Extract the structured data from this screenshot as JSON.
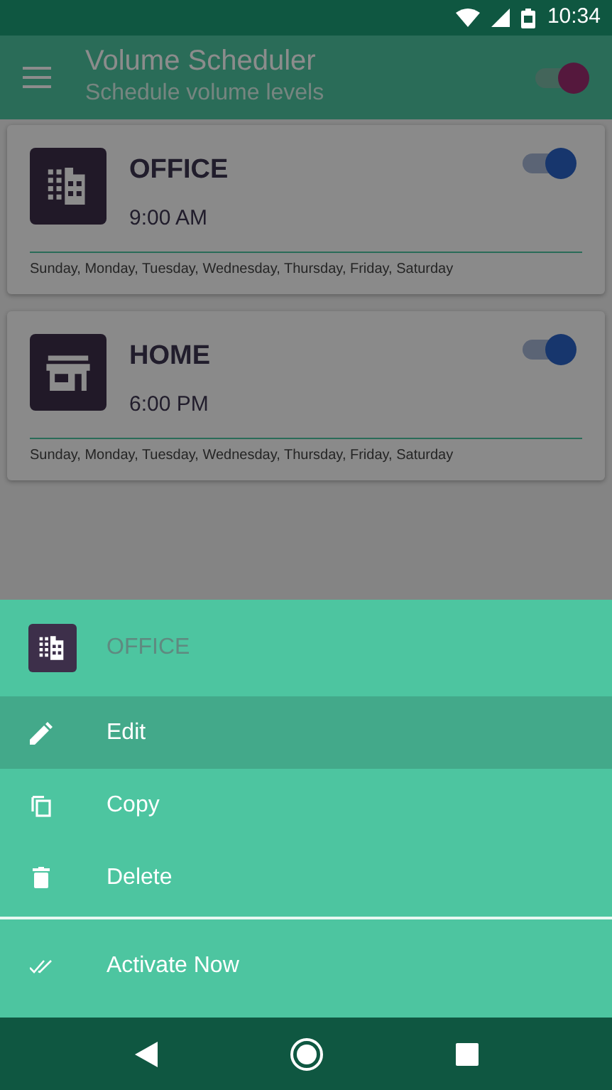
{
  "status_bar": {
    "time": "10:34"
  },
  "app_bar": {
    "title": "Volume Scheduler",
    "subtitle": "Schedule volume levels",
    "switch_on": true
  },
  "schedules": [
    {
      "name": "OFFICE",
      "time": "9:00 AM",
      "days": "Sunday, Monday, Tuesday, Wednesday, Thursday, Friday, Saturday",
      "on": true
    },
    {
      "name": "HOME",
      "time": "6:00 PM",
      "days": "Sunday, Monday, Tuesday, Wednesday, Thursday, Friday, Saturday",
      "on": true
    }
  ],
  "bottom_sheet": {
    "title": "OFFICE",
    "items": [
      {
        "label": "Edit",
        "selected": true,
        "separated": false
      },
      {
        "label": "Copy",
        "selected": false,
        "separated": false
      },
      {
        "label": "Delete",
        "selected": false,
        "separated": false
      },
      {
        "label": "Activate Now",
        "selected": false,
        "separated": true
      }
    ]
  }
}
